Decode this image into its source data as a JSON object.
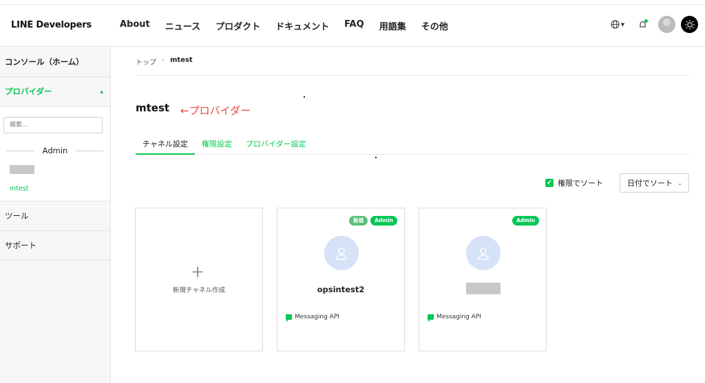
{
  "header": {
    "logo": "LINE Developers",
    "nav": [
      "About",
      "ニュース",
      "プロダクト",
      "ドキュメント",
      "FAQ",
      "用語集",
      "その他"
    ],
    "lang_icon": "globe-icon",
    "notification_icon": "bell-icon",
    "theme_icon": "sun-icon"
  },
  "sidebar": {
    "console_home": "コンソール（ホーム）",
    "providers_label": "プロバイダー",
    "search_placeholder": "検索...",
    "admin_section": "Admin",
    "provider_active": "mtest",
    "tools": "ツール",
    "support": "サポート"
  },
  "breadcrumb": {
    "top": "トップ",
    "current": "mtest"
  },
  "page": {
    "title": "mtest",
    "annotation": "←プロバイダー"
  },
  "tabs": [
    "チャネル設定",
    "権限設定",
    "プロバイダー設定"
  ],
  "sort": {
    "permission_sort_label": "権限でソート",
    "permission_sort_checked": true,
    "date_sort_label": "日付でソート"
  },
  "cards": {
    "new_channel_label": "新規チャネル作成",
    "channels": [
      {
        "name": "opsintest2",
        "badges": [
          "新規",
          "Admin"
        ],
        "type": "Messaging API"
      },
      {
        "name": "",
        "badges": [
          "Admin"
        ],
        "type": "Messaging API"
      }
    ]
  },
  "colors": {
    "accent": "#06c755",
    "annotation": "#e8473e",
    "avatar_bg": "#d6e2f8"
  }
}
